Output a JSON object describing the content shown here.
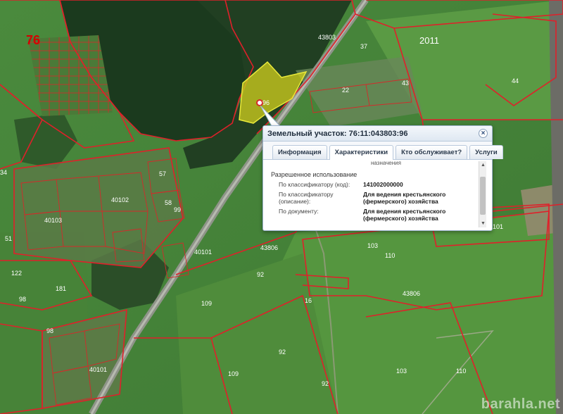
{
  "map": {
    "parcel_labels": {
      "n76": "76",
      "n11": "2011",
      "n43803": "43803",
      "n37": "37",
      "n43": "43",
      "n44": "44",
      "n22": "22",
      "n96": "96",
      "n57": "57",
      "n40102": "40102",
      "n40103": "40103",
      "n58": "58",
      "n99": "99",
      "n34": "34",
      "n51": "51",
      "n40101a": "40101",
      "n43806a": "43806",
      "n43806b": "43806",
      "n103a": "103",
      "n110a": "110",
      "n92a": "92",
      "n109a": "109",
      "n122": "122",
      "n181": "181",
      "n98a": "98",
      "n98b": "98",
      "n16": "16",
      "n40101b": "40101",
      "n92b": "92",
      "n109b": "109",
      "n92c": "92",
      "n103b": "103",
      "n110b": "110",
      "n01": "101"
    }
  },
  "popup": {
    "title": "Земельный участок: 76:11:043803:96",
    "close_icon": "close-icon",
    "tabs": [
      "Информация",
      "Характеристики",
      "Кто обслуживает?",
      "Услуги"
    ],
    "active_tab": 1,
    "cut_text": "назначения",
    "section": "Разрешенное использование",
    "rows": [
      {
        "label": "По классификатору (код):",
        "value": "141002000000"
      },
      {
        "label": "По классификатору (описание):",
        "value": "Для ведения крестьянского (фермерского) хозяйства"
      },
      {
        "label": "По документу:",
        "value": "Для ведения крестьянского (фермерского) хозяйства"
      }
    ]
  },
  "watermark": "barahla.net",
  "colors": {
    "parcel_border": "#e0202a",
    "selected_fill": "#c8c81e",
    "forest": "#1d3a1f",
    "field": "#4f8a3c"
  }
}
